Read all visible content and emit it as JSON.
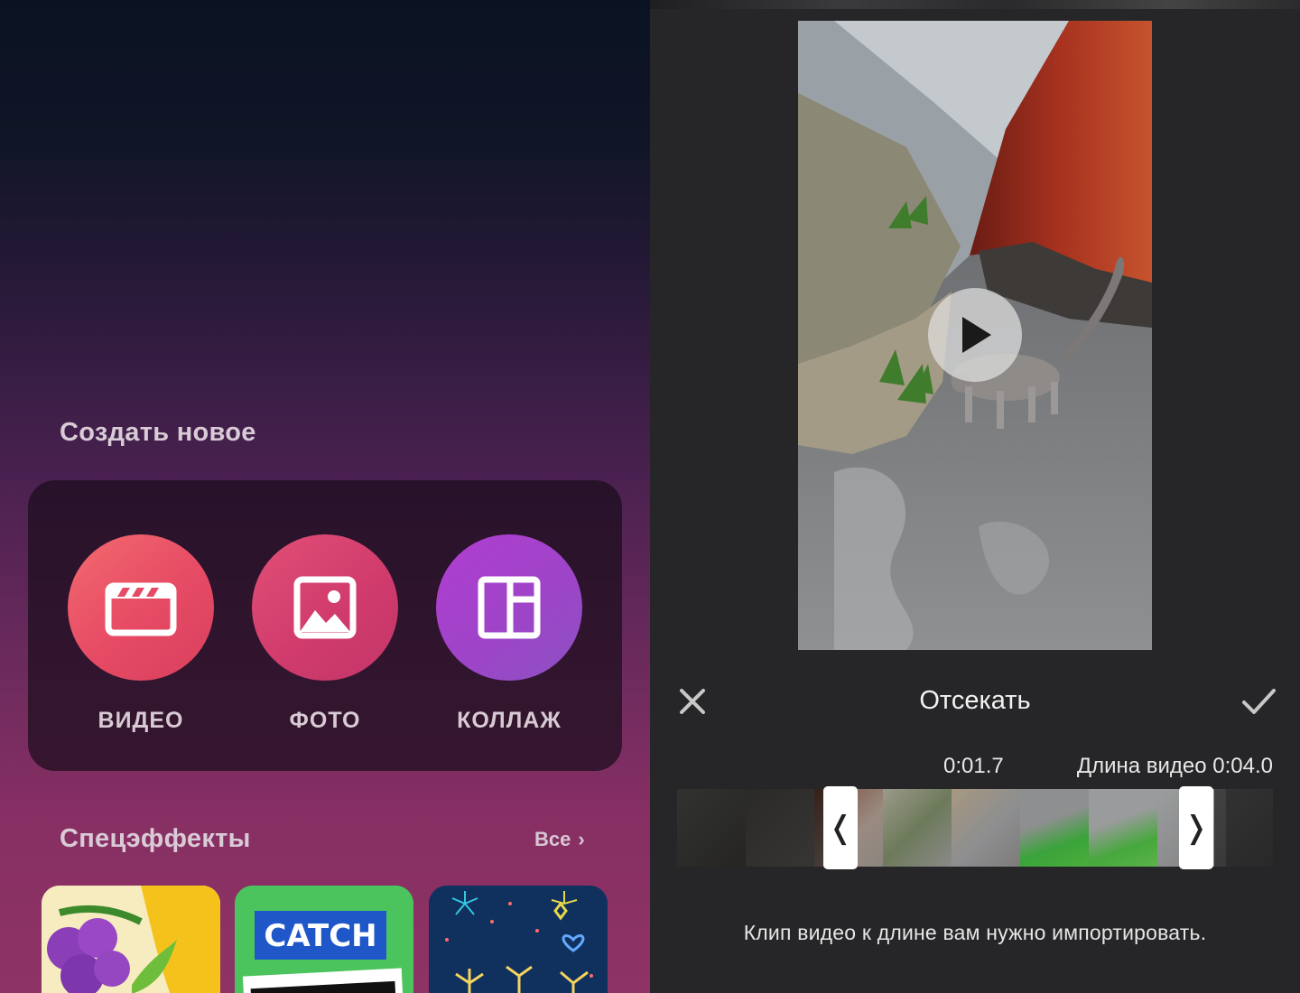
{
  "create_section": {
    "title": "Создать новое",
    "items": [
      {
        "label": "ВИДЕО",
        "icon": "clapperboard-icon"
      },
      {
        "label": "ФОТО",
        "icon": "image-icon"
      },
      {
        "label": "КОЛЛАЖ",
        "icon": "collage-layout-icon"
      }
    ]
  },
  "effects_section": {
    "title": "Спецэффекты",
    "see_all": "Все",
    "tiles": [
      {
        "name": "grape-sticker-effect"
      },
      {
        "name": "catch-effect",
        "text": "CATCH"
      },
      {
        "name": "fireworks-effect"
      }
    ]
  },
  "trim_editor": {
    "title": "Отсекать",
    "current_time": "0:01.7",
    "total_length": "Длина видео 0:04.0",
    "hint": "Клип видео к длине вам нужно импортировать.",
    "selection": {
      "start_fraction": 0.27,
      "end_fraction": 0.88
    }
  },
  "colors": {
    "video_button": "#e64a64",
    "photo_button": "#cf3a6c",
    "collage_button": "#9e44c8",
    "editor_bg": "#262628"
  }
}
